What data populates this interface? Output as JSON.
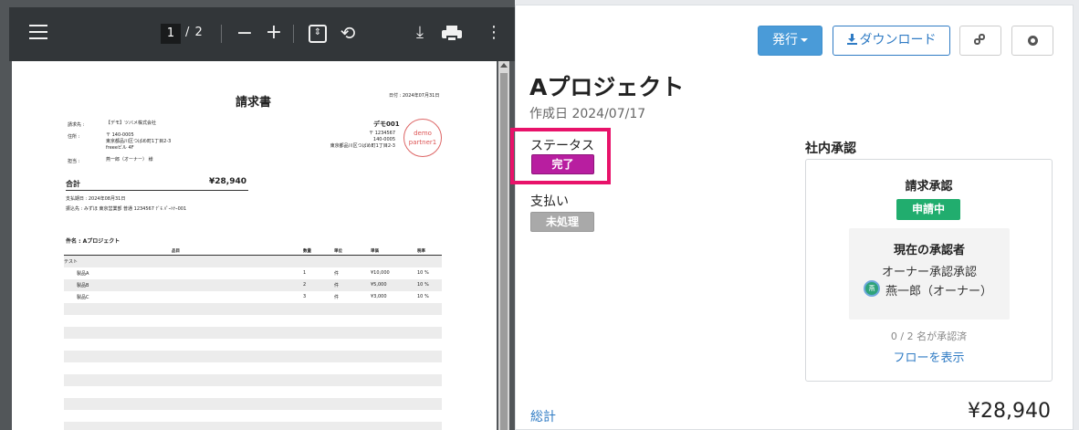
{
  "viewer": {
    "current_page": "1",
    "page_total": "/ 2",
    "zoom_out": "−",
    "zoom_in": "+",
    "rotate": "⟲",
    "download": "⤓",
    "more": "⋮",
    "fit": "⇕"
  },
  "pdf": {
    "title": "請求書",
    "date": "日付 : 2024年07月31日",
    "recipient_label": "請求先 :",
    "recipient_value": "【デモ】ツバメ株式会社",
    "address_label": "住所 :",
    "address_lines": [
      "〒 140-0005",
      "東京都品川区つばめ町1丁目2-3",
      "freeeビル 4F"
    ],
    "contact_label": "担当 :",
    "contact_value": "燕一郎（オーナー） 様",
    "company": "デモ001",
    "company_address": [
      "〒 1234567",
      "140-0005",
      "東京都品川区つばめ町1丁目2-3"
    ],
    "stamp": [
      "demo",
      "partner1"
    ],
    "total_label": "合計",
    "total_value": "¥28,940",
    "due_date": "支払期日 : 2024年08月31日",
    "bank": "振込先 : みずほ 東京営業部 普通 1234567 ﾃﾞﾓ ﾊﾟｰﾄﾅｰ001",
    "subject": "件名 : Aプロジェクト",
    "columns": {
      "name": "品目",
      "qty": "数量",
      "unit": "単位",
      "price": "単価",
      "tax": "税率"
    },
    "group": "テスト",
    "rows": [
      {
        "name": "製品A",
        "qty": "1",
        "unit": "件",
        "price": "¥10,000",
        "tax": "10 %"
      },
      {
        "name": "製品B",
        "qty": "2",
        "unit": "件",
        "price": "¥5,000",
        "tax": "10 %"
      },
      {
        "name": "製品C",
        "qty": "3",
        "unit": "件",
        "price": "¥3,000",
        "tax": "10 %"
      }
    ]
  },
  "panel": {
    "issue_label": "発行",
    "download_label": "ダウンロード",
    "project_title": "Aプロジェクト",
    "created": "作成日 2024/07/17",
    "status_label": "ステータス",
    "status_value": "完了",
    "payment_label": "支払い",
    "payment_value": "未処理",
    "approval_title": "社内承認",
    "request_title": "請求承認",
    "request_status": "申請中",
    "current_approver_title": "現在の承認者",
    "current_step": "オーナー承認承認",
    "avatar_text": "燕",
    "approver_name": "燕一郎（オーナー）",
    "approved_count": "0 / 2 名が承認済",
    "flow_link": "フローを表示",
    "total_label": "総計",
    "total_value": "¥28,940"
  },
  "colors": {
    "status_badge": "#b81ea0",
    "request_badge": "#21ad6e",
    "issue_button": "#4a9bd8",
    "highlight": "#e8126a"
  }
}
